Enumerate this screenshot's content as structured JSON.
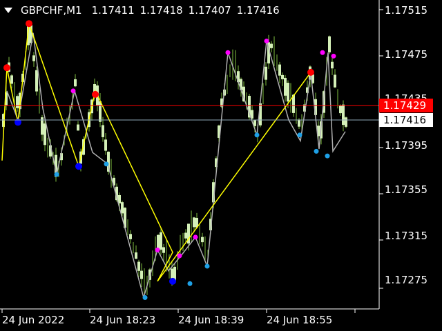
{
  "header": {
    "symbol": "GBPCHF,M1",
    "ohlc": [
      "1.17411",
      "1.17418",
      "1.17407",
      "1.17416"
    ]
  },
  "price_axis": {
    "labels": [
      "1.17515",
      "1.17475",
      "1.17435",
      "1.17395",
      "1.17355",
      "1.17315",
      "1.17275"
    ]
  },
  "time_axis": {
    "labels": [
      "24 Jun 2022",
      "24 Jun 18:23",
      "24 Jun 18:39",
      "24 Jun 18:55"
    ]
  },
  "markers": {
    "red_line": {
      "value": "1.17429",
      "color": "#ff0000"
    },
    "bid_line": {
      "value": "1.17416",
      "color": "#8fa8b8"
    }
  },
  "colors": {
    "background": "#000000",
    "axis": "#ffffff",
    "candle": "#d4f0b8",
    "wick": "#7fbf3f",
    "zigzag_major": "#ffff00",
    "zigzag_minor": "#b0b0b0",
    "swing_high": "#ff0000",
    "swing_low": "#0000ff",
    "minor_high": "#ff00ff",
    "minor_low": "#1ea0e6"
  },
  "chart_data": {
    "type": "candlestick",
    "ylim": [
      1.17255,
      1.1753
    ],
    "zigzag_major": [
      1.17385,
      1.17465,
      1.17418,
      1.17503,
      1.1738,
      1.17445,
      1.17306,
      1.17281,
      1.17461
    ],
    "zigzag_minor": [
      1.17445,
      1.17373,
      1.17445,
      1.17382,
      1.17308,
      1.17267,
      1.17303,
      1.17279,
      1.17319,
      1.17294,
      1.17478,
      1.17407,
      1.17478,
      1.17407,
      1.17478,
      1.17393,
      1.17478,
      1.17389
    ],
    "swing_highs": [
      1.17465,
      1.17503,
      1.17442,
      1.17461
    ],
    "swing_lows": [
      1.17418,
      1.1738,
      1.17281
    ],
    "minor_highs": [
      1.17445,
      1.17445,
      1.17308,
      1.17303,
      1.17319,
      1.17478,
      1.17478,
      1.17478
    ],
    "minor_lows": [
      1.17373,
      1.17382,
      1.17267,
      1.17279,
      1.17294,
      1.17407,
      1.17407,
      1.17393,
      1.17389
    ]
  }
}
